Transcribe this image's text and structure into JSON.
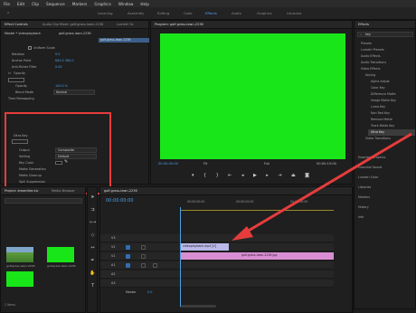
{
  "menu": [
    "File",
    "Edit",
    "Clip",
    "Sequence",
    "Markers",
    "Graphics",
    "Window",
    "Help"
  ],
  "workspaces": [
    "Learning",
    "Assembly",
    "Editing",
    "Color",
    "Effects",
    "Audio",
    "Graphics",
    "Libraries"
  ],
  "effect_controls": {
    "tabs": [
      "Effect Controls",
      "Audio Clip Mixer: golf-grass-lawn-2236",
      "Lumetri Sc"
    ],
    "header": "Master * videoplayback",
    "clip": "golf-grass-lawn-2236",
    "rows": [
      {
        "label": "Uniform Scale"
      },
      {
        "label": "Rotation",
        "value": "0.0"
      },
      {
        "label": "Anchor Point",
        "value": "640.0   360.0"
      },
      {
        "label": "Anti-flicker Filter",
        "value": "0.00"
      },
      {
        "label": "Opacity"
      },
      {
        "label": "Opacity",
        "value": "100.0 %"
      },
      {
        "label": "Blend Mode",
        "value": "Normal"
      },
      {
        "label": "Time Remapping"
      },
      {
        "label": "Ultra Key"
      },
      {
        "label": "Output",
        "value": "Composite"
      },
      {
        "label": "Setting",
        "value": "Default"
      },
      {
        "label": "Key Color"
      },
      {
        "label": "Matte Generation"
      },
      {
        "label": "Matte Cleanup"
      },
      {
        "label": "Spill Suppression"
      },
      {
        "label": "Color Correction"
      }
    ],
    "timecode": "00:00:00:00"
  },
  "program_monitor": {
    "title": "Program: golf-grass-lawn-2236",
    "timecode": "00:00:00:00",
    "fit": "Fit",
    "quality": "Full",
    "duration": "00:00:15:00"
  },
  "effects_panel": {
    "title": "Effects",
    "search_value": "key",
    "items": [
      "Presets",
      "Lumetri Presets",
      "Audio Effects",
      "Audio Transitions",
      "Video Effects",
      "Keying",
      "Alpha Adjust",
      "Color Key",
      "Difference Matte",
      "Image Matte Key",
      "Luma Key",
      "Non Red Key",
      "Remove Matte",
      "Track Matte Key",
      "Ultra Key",
      "Video Transitions"
    ],
    "lower": [
      "Essential Graphics",
      "Essential Sound",
      "Lumetri Color",
      "Libraries",
      "Markers",
      "History",
      "Info"
    ]
  },
  "project_panel": {
    "tabs": [
      "Project: dreamlike.kic",
      "Media Browser"
    ],
    "search_placeholder": "",
    "items": [
      "golf-grass-lawn-2236",
      "golf-grass-lawn-2236"
    ],
    "count": "2 Items"
  },
  "timeline": {
    "title": "golf-grass-lawn-2236",
    "timecode": "00:00:00:00",
    "ruler": [
      "00:00:00:00",
      "00:00:05:00",
      "00:00:10:00"
    ],
    "tracks": [
      "V3",
      "V2",
      "V1",
      "A1",
      "A2",
      "A3"
    ],
    "clip_v2": "videoplayback.mp4 [V]",
    "clip_v1": "golf-grass-lawn-2236.jpg",
    "master": "Master",
    "master_value": "0.0"
  },
  "colors": {
    "annotation": "#e63c3c",
    "green_screen": "#19e619",
    "accent": "#4a9fe8"
  }
}
